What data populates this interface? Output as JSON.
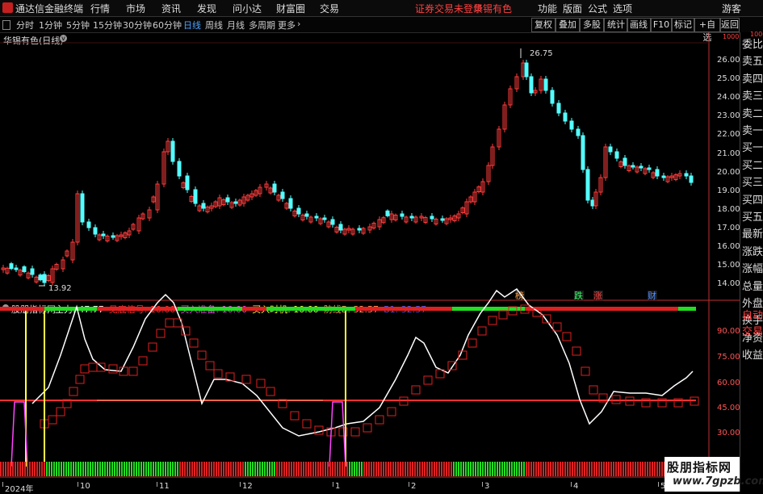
{
  "app": {
    "title": "通达信金融终端",
    "menu": [
      "行情",
      "市场",
      "资讯",
      "发现",
      "问小达",
      "财富圈",
      "交易"
    ],
    "login_notice": "证券交易未登录",
    "stock_name": "华锡有色",
    "right_menu": [
      "功能",
      "版面",
      "公式",
      "选项"
    ],
    "guest": "游客"
  },
  "toolbar": {
    "periods": [
      "分时",
      "1分钟",
      "5分钟",
      "15分钟",
      "30分钟",
      "60分钟",
      "日线",
      "周线",
      "月线",
      "多周期",
      "更多"
    ],
    "active_period": "日线",
    "right_buttons": [
      "复权",
      "叠加",
      "多股",
      "统计",
      "画线",
      "F10",
      "标记",
      "+自选",
      "返回"
    ]
  },
  "main_chart": {
    "label": "华锡有色(日线)",
    "high_label": "26.75",
    "low_label": "13.92",
    "y_ticks": [
      "26.00",
      "25.00",
      "24.00",
      "23.00",
      "22.00",
      "21.00",
      "20.00",
      "19.00",
      "18.00",
      "17.00",
      "16.00",
      "15.00",
      "14.00"
    ],
    "markers": [
      {
        "text": "榜",
        "color": "#ff9a3c"
      },
      {
        "text": "跌",
        "color": "#33ff66"
      },
      {
        "text": "涨",
        "color": "#ff4040"
      },
      {
        "text": "财",
        "color": "#4f8dff"
      }
    ],
    "top_label": "1000"
  },
  "indicator": {
    "name": "股朋指标网",
    "items": [
      {
        "label": "主力: 47.77",
        "color": "#ffffff"
      },
      {
        "label": "见底信号: 10.00",
        "color": "#ff3333"
      },
      {
        "label": "买入准备: 10.00",
        "color": "#ff44ff"
      },
      {
        "label": "买入时机: 10.00",
        "color": "#ffff44"
      },
      {
        "label": "防线B: 32.57",
        "color": "#ff9a60"
      },
      {
        "label": "B1: 32.57",
        "color": "#4060ff"
      }
    ],
    "y_ticks": [
      "90.00",
      "75.00",
      "60.00",
      "45.00",
      "30.00"
    ]
  },
  "x_axis": [
    "2024年",
    "10",
    "11",
    "12",
    "1",
    "2",
    "3",
    "4",
    "5"
  ],
  "sidebar": [
    "委比",
    "卖五",
    "卖四",
    "卖三",
    "卖二",
    "卖一",
    "买一",
    "买二",
    "买三",
    "买四",
    "买五",
    "最新",
    "涨跌",
    "涨幅",
    "总量",
    "外盘",
    "换手",
    "净资",
    "收益",
    "自动",
    "交易"
  ],
  "sidebar_top": "1000",
  "watermark": {
    "title": "股朋指标网",
    "url": "www.7gpzb.com"
  },
  "colors": {
    "up": "#ff3b3b",
    "down": "#54ffff",
    "ma": "#ffffff",
    "accent": "#4fa3ff"
  }
}
